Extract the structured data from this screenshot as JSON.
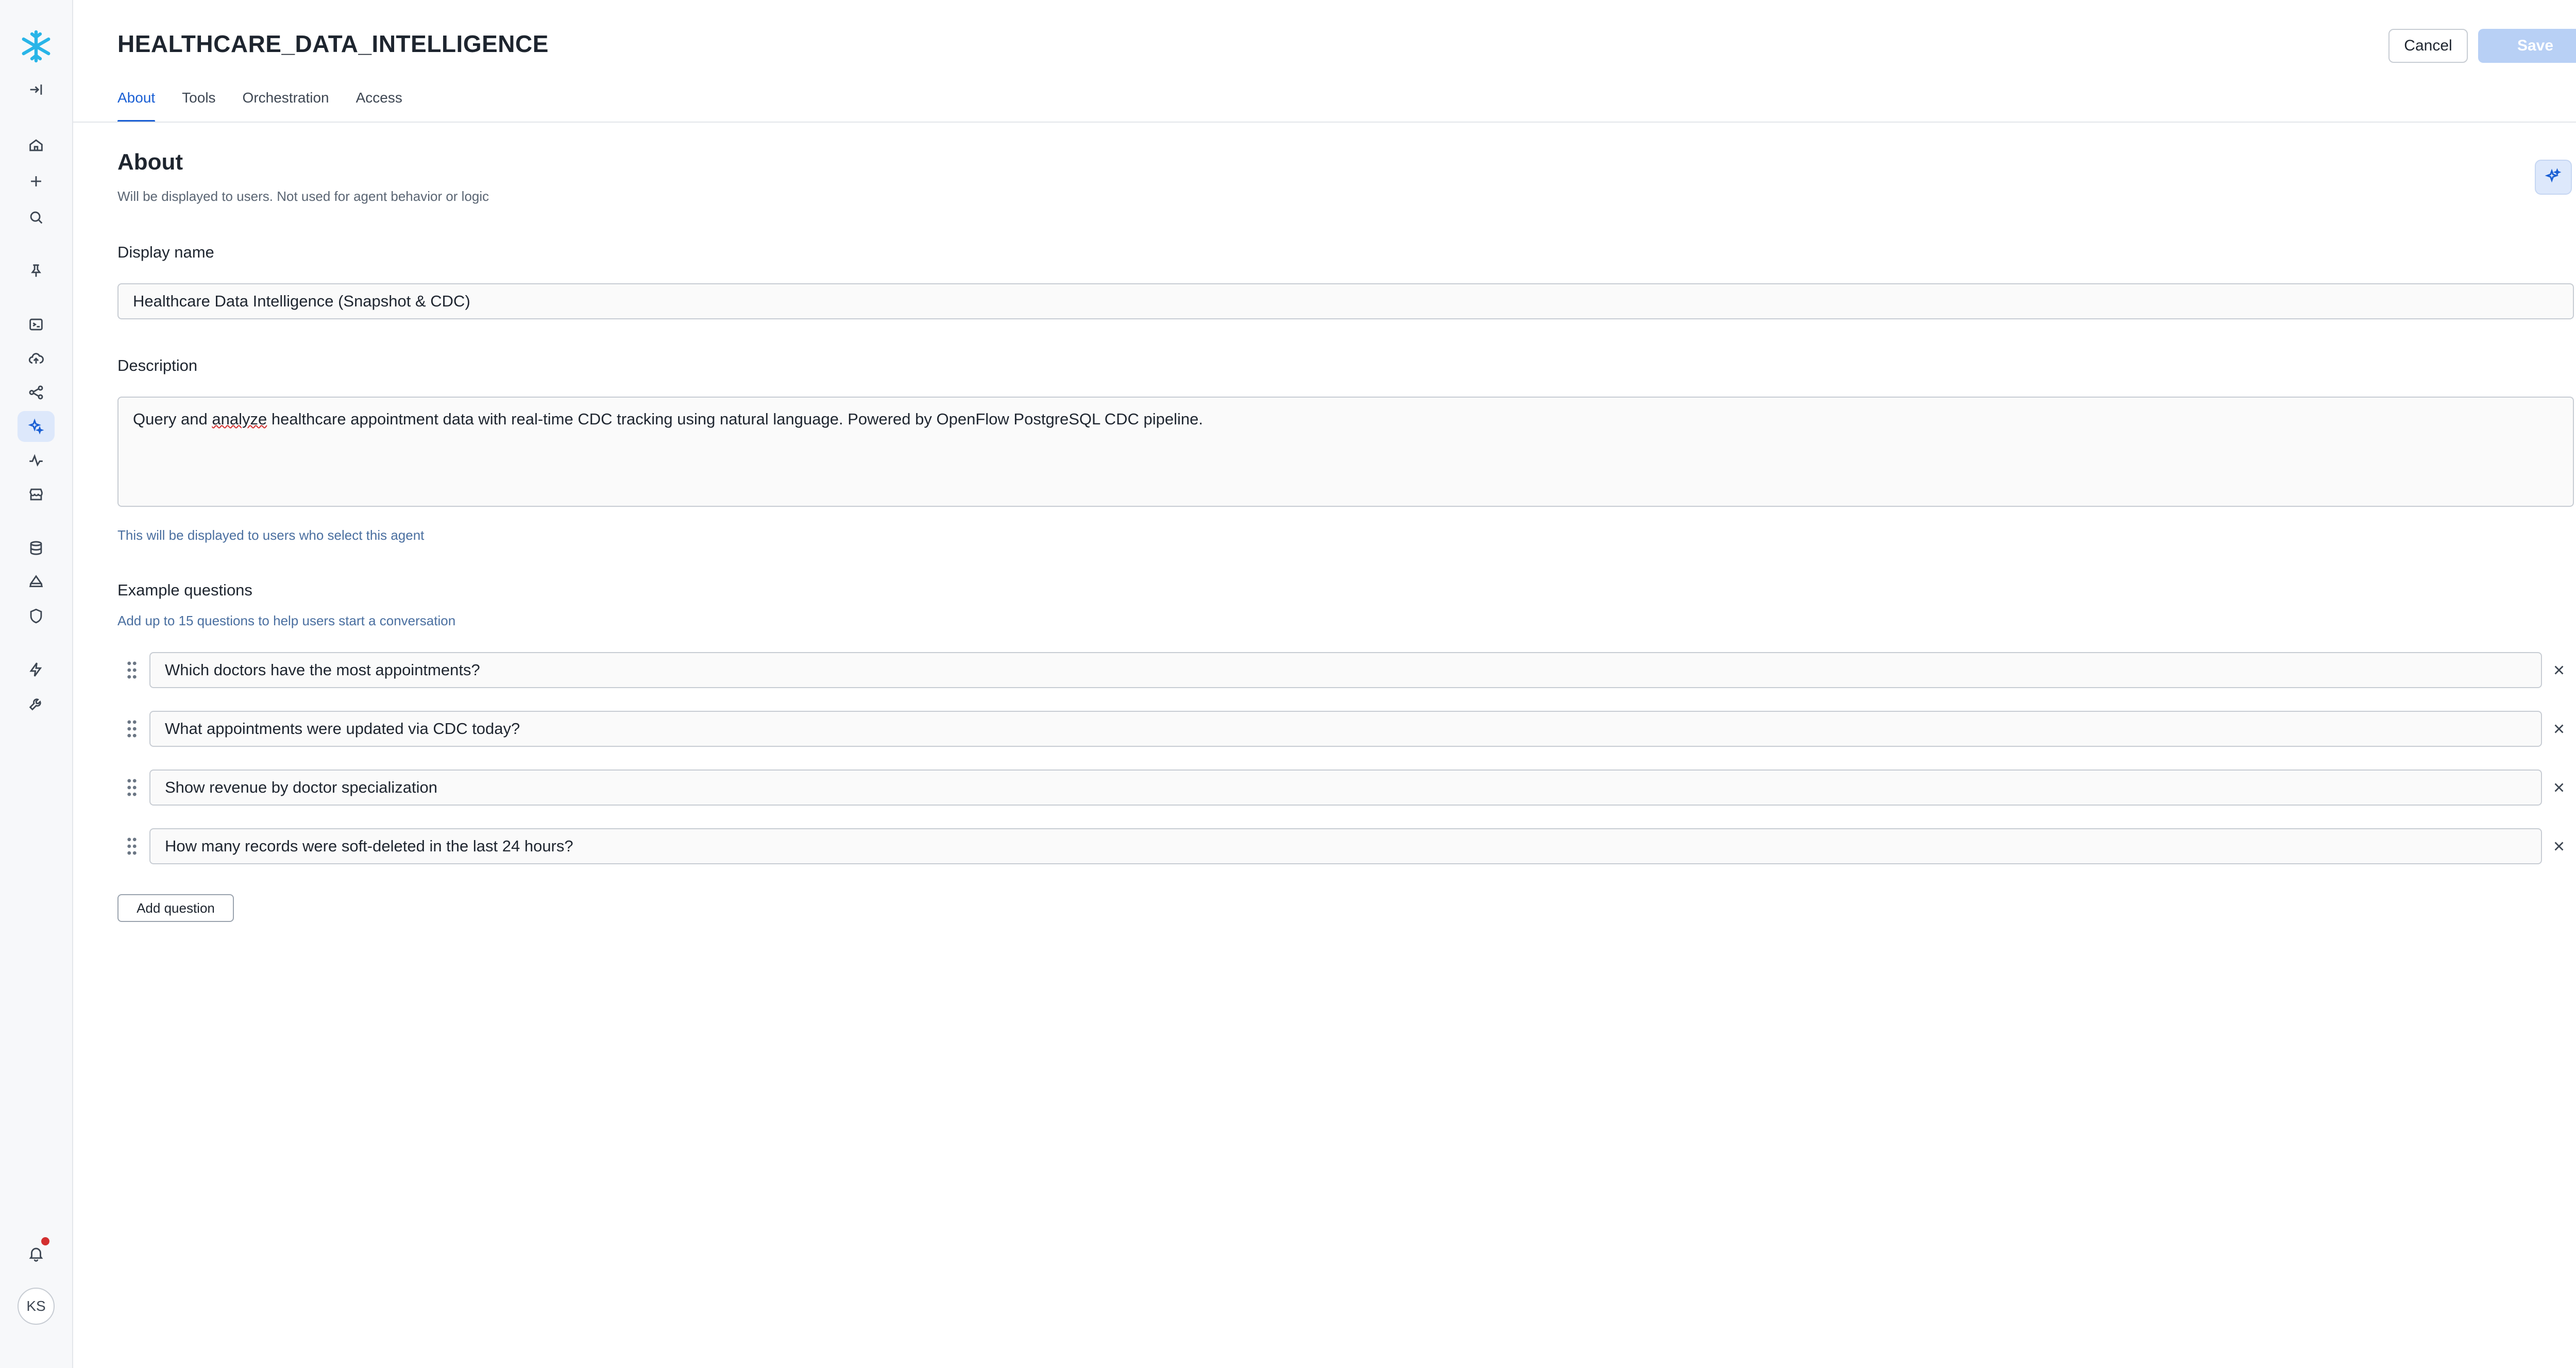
{
  "header": {
    "title": "HEALTHCARE_DATA_INTELLIGENCE",
    "cancel_label": "Cancel",
    "save_label": "Save"
  },
  "tabs": [
    {
      "label": "About",
      "active": true
    },
    {
      "label": "Tools",
      "active": false
    },
    {
      "label": "Orchestration",
      "active": false
    },
    {
      "label": "Access",
      "active": false
    }
  ],
  "sidebar": {
    "items": [
      {
        "icon": "collapse-sidebar-icon"
      },
      {
        "icon": "home-icon"
      },
      {
        "icon": "plus-icon"
      },
      {
        "icon": "search-icon"
      },
      {
        "icon": "pin-icon"
      },
      {
        "icon": "worksheet-icon"
      },
      {
        "icon": "cloud-upload-icon"
      },
      {
        "icon": "data-flow-icon"
      },
      {
        "icon": "ai-sparkle-icon",
        "active": true
      },
      {
        "icon": "activity-icon"
      },
      {
        "icon": "marketplace-icon"
      },
      {
        "icon": "database-icon"
      },
      {
        "icon": "cloud-share-icon"
      },
      {
        "icon": "shield-icon"
      },
      {
        "icon": "lightning-icon"
      },
      {
        "icon": "settings-wrench-icon"
      }
    ],
    "avatar_initials": "KS",
    "accent_color": "#1a5fd4"
  },
  "about": {
    "title": "About",
    "subtitle": "Will be displayed to users. Not used for agent behavior or logic",
    "display_name_label": "Display name",
    "display_name_value": "Healthcare Data Intelligence (Snapshot & CDC)",
    "description_label": "Description",
    "description_before": "Query and ",
    "description_misspelled": "analyze",
    "description_after": " healthcare appointment data with real-time CDC tracking using natural language. Powered by OpenFlow PostgreSQL CDC pipeline.",
    "description_hint": "This will be displayed to users who select this agent",
    "examples_label": "Example questions",
    "examples_hint": "Add up to 15 questions to help users start a conversation",
    "questions": [
      "Which doctors have the most appointments?",
      "What appointments were updated via CDC today?",
      "Show revenue by doctor specialization",
      "How many records were soft-deleted in the last 24 hours?"
    ],
    "add_question_label": "Add question"
  }
}
